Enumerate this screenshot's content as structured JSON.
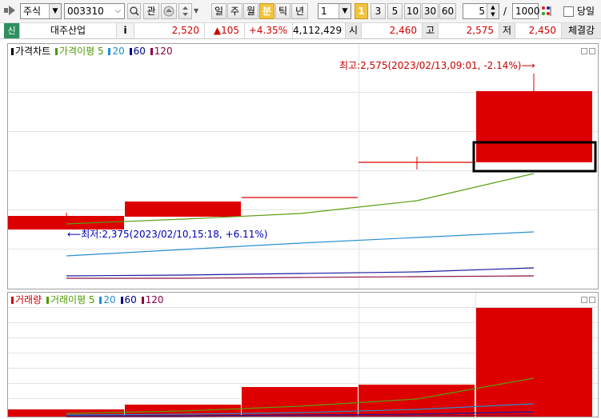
{
  "toolbar": {
    "market_select": "주식",
    "code_input": "003310",
    "search_icon": "search-icon",
    "watch_label": "관",
    "period_buttons": [
      "일",
      "주",
      "월",
      "분",
      "틱",
      "년"
    ],
    "active_period": "분",
    "interval_select": "1",
    "minute_buttons": [
      "1",
      "3",
      "5",
      "10",
      "30",
      "60"
    ],
    "active_minute": "1",
    "zoom_value": "5",
    "divider": "/",
    "count_value": "1000",
    "today_label": "당일"
  },
  "quote": {
    "tag": "신",
    "name": "대주산업",
    "info_label": "i",
    "price": "2,520",
    "change": "▲105",
    "change_pct": "+4.35%",
    "volume": "4,112,429",
    "open_label": "시",
    "open_value": "2,460",
    "high_label": "고",
    "high_value": "2,575",
    "low_label": "저",
    "low_value": "2,450",
    "exec_label": "체결강"
  },
  "price_panel": {
    "legend": [
      {
        "text": "가격차트",
        "color": "#000000"
      },
      {
        "text": "가격이평 5",
        "color": "#4d9a00"
      },
      {
        "text": "20",
        "color": "#1f8fd0"
      },
      {
        "text": "60",
        "color": "#00008b"
      },
      {
        "text": "120",
        "color": "#8b0040"
      }
    ],
    "high_annotation": "최고:2,575(2023/02/13,09:01, -2.14%)⟶",
    "low_annotation": "⟵최저:2,375(2023/02/10,15:18, +6.11%)"
  },
  "volume_panel": {
    "legend": [
      {
        "text": "거래량",
        "color": "#d10000"
      },
      {
        "text": "거래이평 5",
        "color": "#4d9a00"
      },
      {
        "text": "20",
        "color": "#1f8fd0"
      },
      {
        "text": "60",
        "color": "#00008b"
      },
      {
        "text": "120",
        "color": "#8b0040"
      }
    ]
  },
  "colors": {
    "up": "#dd0000",
    "ma5": "#5a9e10",
    "ma20": "#2a8fd0",
    "ma60": "#1a1aa0",
    "ma120": "#8b1040",
    "highlight_box": "#000000"
  }
}
